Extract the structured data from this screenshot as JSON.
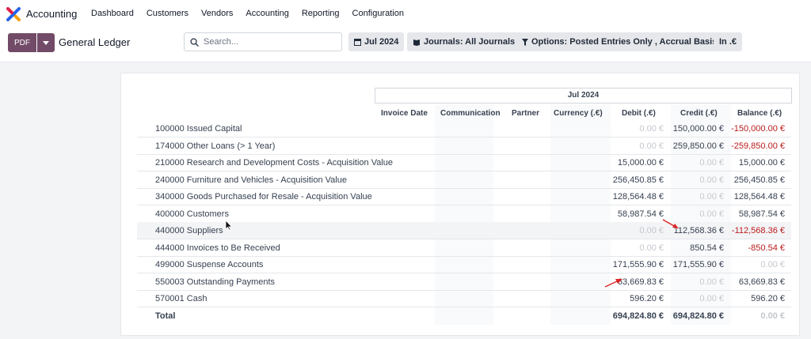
{
  "app": {
    "name": "Accounting"
  },
  "menu": [
    "Dashboard",
    "Customers",
    "Vendors",
    "Accounting",
    "Reporting",
    "Configuration"
  ],
  "control": {
    "pdf_label": "PDF",
    "title": "General Ledger",
    "search_placeholder": "Search...",
    "filters": {
      "date": "Jul 2024",
      "journals": "Journals: All Journals",
      "options": "Options: Posted Entries Only , Accrual Basis",
      "currency": "In .€"
    }
  },
  "report": {
    "period": "Jul 2024",
    "columns": [
      "Invoice Date",
      "Communication",
      "Partner",
      "Currency (.€)",
      "Debit (.€)",
      "Credit (.€)",
      "Balance (.€)"
    ],
    "rows": [
      {
        "name": "100000 Issued Capital",
        "debit": "0.00 €",
        "credit": "150,000.00 €",
        "balance": "-150,000.00 €"
      },
      {
        "name": "174000 Other Loans (> 1 Year)",
        "debit": "0.00 €",
        "credit": "259,850.00 €",
        "balance": "-259,850.00 €"
      },
      {
        "name": "210000 Research and Development Costs - Acquisition Value",
        "debit": "15,000.00 €",
        "credit": "0.00 €",
        "balance": "15,000.00 €"
      },
      {
        "name": "240000 Furniture and Vehicles - Acquisition Value",
        "debit": "256,450.85 €",
        "credit": "0.00 €",
        "balance": "256,450.85 €"
      },
      {
        "name": "340000 Goods Purchased for Resale - Acquisition Value",
        "debit": "128,564.48 €",
        "credit": "0.00 €",
        "balance": "128,564.48 €"
      },
      {
        "name": "400000 Customers",
        "debit": "58,987.54 €",
        "credit": "0.00 €",
        "balance": "58,987.54 €"
      },
      {
        "name": "440000 Suppliers",
        "debit": "0.00 €",
        "credit": "112,568.36 €",
        "balance": "-112,568.36 €"
      },
      {
        "name": "444000 Invoices to Be Received",
        "debit": "0.00 €",
        "credit": "850.54 €",
        "balance": "-850.54 €"
      },
      {
        "name": "499000 Suspense Accounts",
        "debit": "171,555.90 €",
        "credit": "171,555.90 €",
        "balance": "0.00 €"
      },
      {
        "name": "550003 Outstanding Payments",
        "debit": "63,669.83 €",
        "credit": "0.00 €",
        "balance": "63,669.83 €"
      },
      {
        "name": "570001 Cash",
        "debit": "596.20 €",
        "credit": "0.00 €",
        "balance": "596.20 €"
      }
    ],
    "total": {
      "name": "Total",
      "debit": "694,824.80 €",
      "credit": "694,824.80 €",
      "balance": "0.00 €"
    }
  },
  "colors": {
    "brand": "#714b67",
    "negative": "#b91c1c",
    "annotation": "#dc2626"
  }
}
